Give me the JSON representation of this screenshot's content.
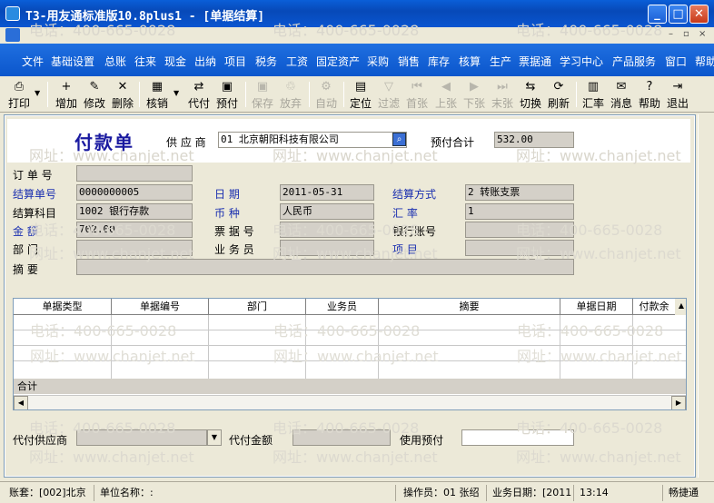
{
  "window": {
    "title": "T3-用友通标准版10.8plus1 - [单据结算]",
    "minimize_glyph": "_",
    "maximize_glyph": "□",
    "close_glyph": "✕"
  },
  "mdi": {
    "minimize_glyph": "–",
    "restore_glyph": "▫",
    "close_glyph": "×"
  },
  "menu": [
    "文件",
    "基础设置",
    "总账",
    "往来",
    "现金",
    "出纳",
    "项目",
    "税务",
    "工资",
    "固定资产",
    "采购",
    "销售",
    "库存",
    "核算",
    "生产",
    "票据通",
    "学习中心",
    "产品服务",
    "窗口",
    "帮助"
  ],
  "toolbar": [
    {
      "label": "打印",
      "icon": "printer-icon",
      "glyph": "⎙",
      "enabled": true
    },
    {
      "label": "增加",
      "icon": "add-icon",
      "glyph": "+",
      "enabled": true
    },
    {
      "label": "修改",
      "icon": "edit-icon",
      "glyph": "✎",
      "enabled": true
    },
    {
      "label": "删除",
      "icon": "delete-icon",
      "glyph": "✕",
      "enabled": true
    },
    {
      "label": "核销",
      "icon": "verify-icon",
      "glyph": "▦",
      "enabled": true
    },
    {
      "label": "代付",
      "icon": "agent-pay-icon",
      "glyph": "⇄",
      "enabled": true
    },
    {
      "label": "预付",
      "icon": "prepay-icon",
      "glyph": "▣",
      "enabled": true
    },
    {
      "label": "保存",
      "icon": "save-icon",
      "glyph": "▣",
      "enabled": false
    },
    {
      "label": "放弃",
      "icon": "discard-icon",
      "glyph": "♲",
      "enabled": false
    },
    {
      "label": "自动",
      "icon": "auto-icon",
      "glyph": "⚙",
      "enabled": false
    },
    {
      "label": "定位",
      "icon": "locate-icon",
      "glyph": "▤",
      "enabled": true
    },
    {
      "label": "过滤",
      "icon": "filter-icon",
      "glyph": "▽",
      "enabled": false
    },
    {
      "label": "首张",
      "icon": "first-icon",
      "glyph": "⏮",
      "enabled": false
    },
    {
      "label": "上张",
      "icon": "prev-icon",
      "glyph": "◀",
      "enabled": false
    },
    {
      "label": "下张",
      "icon": "next-icon",
      "glyph": "▶",
      "enabled": false
    },
    {
      "label": "末张",
      "icon": "last-icon",
      "glyph": "⏭",
      "enabled": false
    },
    {
      "label": "切换",
      "icon": "switch-icon",
      "glyph": "⇆",
      "enabled": true
    },
    {
      "label": "刷新",
      "icon": "refresh-icon",
      "glyph": "⟳",
      "enabled": true
    },
    {
      "label": "汇率",
      "icon": "rate-icon",
      "glyph": "▥",
      "enabled": true
    },
    {
      "label": "消息",
      "icon": "message-icon",
      "glyph": "✉",
      "enabled": true
    },
    {
      "label": "帮助",
      "icon": "help-icon",
      "glyph": "?",
      "enabled": true
    },
    {
      "label": "退出",
      "icon": "exit-icon",
      "glyph": "⇥",
      "enabled": true
    }
  ],
  "form": {
    "title": "付款单",
    "supplier_label": "供 应 商",
    "supplier_value": "01  北京朝阳科技有限公司",
    "prepay_total_label": "预付合计",
    "prepay_total_value": "532.00",
    "order_no_label": "订 单 号",
    "order_no_value": "",
    "settle_no_label": "结算单号",
    "settle_no_value": "0000000005",
    "date_label": "日    期",
    "date_value": "2011-05-31",
    "settle_method_label": "结算方式",
    "settle_method_value": "2  转账支票",
    "settle_subject_label": "结算科目",
    "settle_subject_value": "1002  银行存款",
    "currency_label": "币    种",
    "currency_value": "人民币",
    "rate_label": "汇    率",
    "rate_value": "1",
    "amount_label": "金    额",
    "amount_value": "702.00",
    "bill_no_label": "票 据 号",
    "bill_no_value": "",
    "bank_account_label": "银行账号",
    "bank_account_value": "",
    "dept_label": "部    门",
    "dept_value": "",
    "salesman_label": "业 务 员",
    "salesman_value": "",
    "project_label": "项    目",
    "project_value": "",
    "summary_label": "摘    要",
    "summary_value": ""
  },
  "grid": {
    "columns": [
      "单据类型",
      "单据编号",
      "部门",
      "业务员",
      "摘要",
      "单据日期",
      "付款余"
    ],
    "total_label": "合计"
  },
  "footer": {
    "agent_supplier_label": "代付供应商",
    "agent_supplier_value": "",
    "agent_amount_label": "代付金额",
    "agent_amount_value": "",
    "use_prepay_label": "使用预付",
    "use_prepay_value": ""
  },
  "statusbar": {
    "account": "账套：[002]北京",
    "unit": "单位名称：:",
    "operator": "操作员：01 张绍",
    "business_date": "业务日期：[2011",
    "time": "13:14",
    "hotline": "畅捷通"
  },
  "watermark": {
    "phone": "电话：400-665-0028",
    "site": "网址：www.chanjet.net"
  }
}
